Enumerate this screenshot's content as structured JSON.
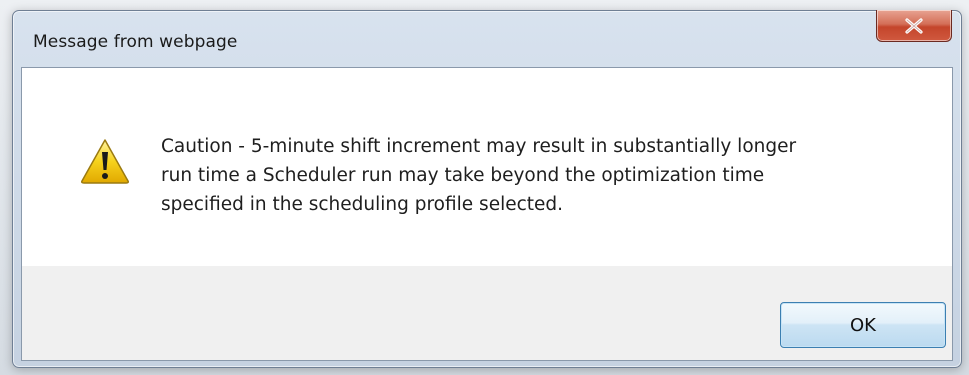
{
  "dialog": {
    "title": "Message from webpage",
    "close_symbol": "X",
    "icon": "warning-icon",
    "message_lines": [
      "Caution - 5-minute shift increment may result in substantially longer",
      "run time a Scheduler run may take beyond the optimization time",
      "specified in the scheduling profile selected."
    ],
    "ok_label": "OK"
  },
  "colors": {
    "close_button": "#c4452b",
    "ok_border": "#3c7fb1",
    "warning_fill": "#f5c400"
  }
}
